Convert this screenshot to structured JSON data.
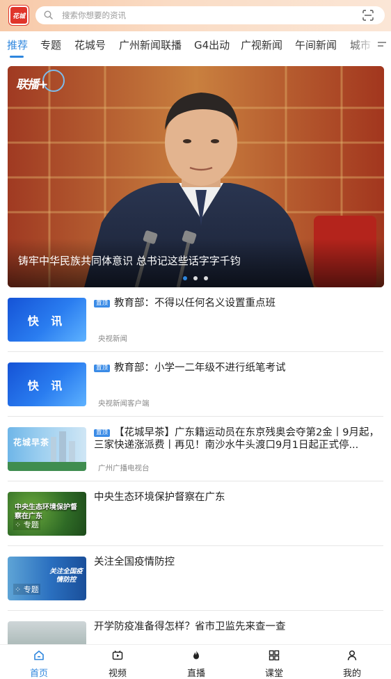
{
  "header": {
    "logo_text": "花城",
    "search_placeholder": "搜索你想要的资讯"
  },
  "tabs": [
    {
      "label": "推荐",
      "active": true
    },
    {
      "label": "专题"
    },
    {
      "label": "花城号"
    },
    {
      "label": "广州新闻联播"
    },
    {
      "label": "G4出动"
    },
    {
      "label": "广视新闻"
    },
    {
      "label": "午间新闻"
    },
    {
      "label": "城市"
    }
  ],
  "banner": {
    "watermark": "联播+",
    "caption": "铸牢中华民族共同体意识  总书记这些话字字千钧",
    "slide_count": 3,
    "active_slide": 1
  },
  "news": [
    {
      "thumb_text": "快 讯",
      "pin": "置顶",
      "title": "教育部：不得以任何名义设置重点班",
      "source": "央视新闻"
    },
    {
      "thumb_text": "快 讯",
      "pin": "置顶",
      "title": "教育部：小学一二年级不进行纸笔考试",
      "source": "央视新闻客户端"
    },
    {
      "thumb_text": "花城早茶",
      "pin": "置顶",
      "title": "【花城早茶】广东籍运动员在东京残奥会夺第2金丨9月起，三家快递涨派费丨再见！南沙水牛头渡口9月1日起正式停...",
      "source": "广州广播电视台"
    },
    {
      "thumb_text": "中央生态环境保护督察在广东",
      "thumb_tag": "专题",
      "title": "中央生态环境保护督察在广东",
      "source": ""
    },
    {
      "thumb_text": "关注全国疫情防控",
      "thumb_tag": "专题",
      "title": "关注全国疫情防控",
      "source": ""
    },
    {
      "title": "开学防疫准备得怎样？省市卫监先来查一查",
      "source": ""
    }
  ],
  "bottom_nav": [
    {
      "label": "首页",
      "icon": "home-icon",
      "active": true
    },
    {
      "label": "视频",
      "icon": "video-icon"
    },
    {
      "label": "直播",
      "icon": "flame-icon"
    },
    {
      "label": "课堂",
      "icon": "grid-icon"
    },
    {
      "label": "我的",
      "icon": "user-icon"
    }
  ],
  "colors": {
    "accent": "#2e86de",
    "pin": "#3a8be6",
    "logo": "#e0352b"
  }
}
